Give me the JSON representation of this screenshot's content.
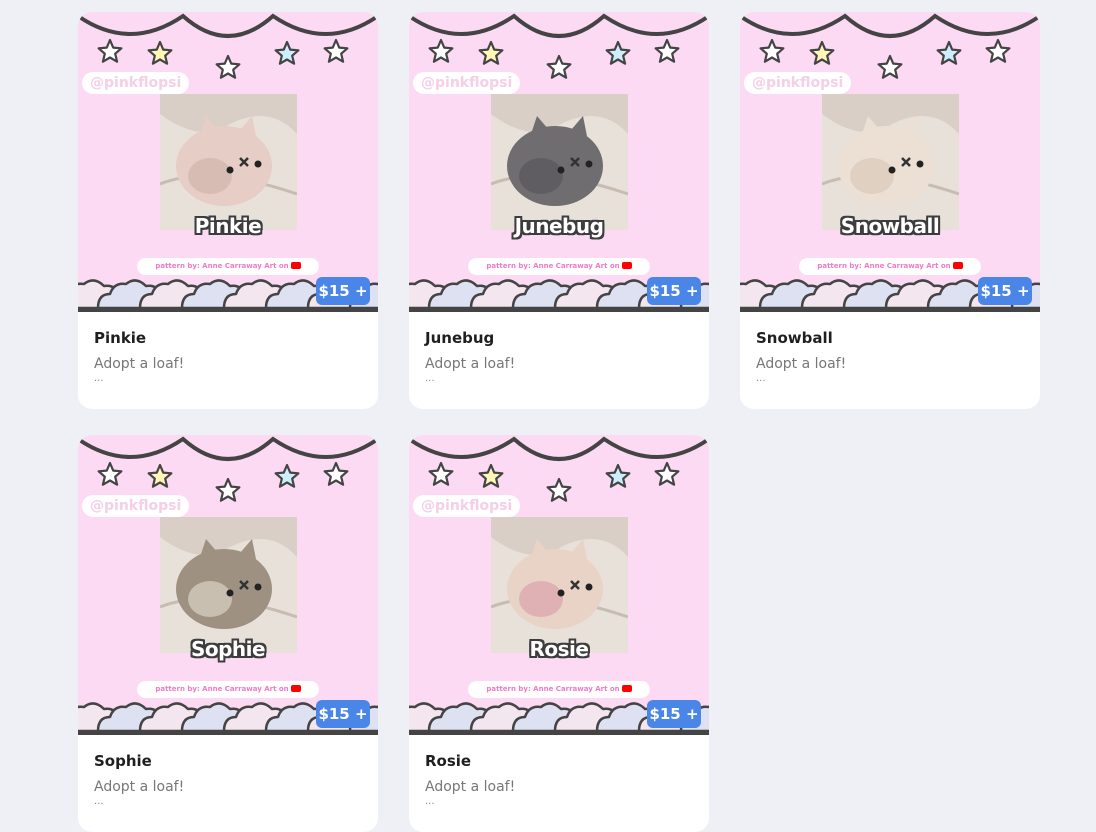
{
  "handle": "@pinkflopsi",
  "credit": "pattern by: Anne Carraway Art on",
  "colors": {
    "background": "#eef0f6",
    "thumb_pink": "#fcdaf3",
    "price_blue": "#4a86e8"
  },
  "products": [
    {
      "name": "Pinkie",
      "desc": "Adopt a loaf!",
      "more": "...",
      "price": "$15 +",
      "plush_color": "#e6cdc5",
      "plush_shade": "#cdb1a8"
    },
    {
      "name": "Junebug",
      "desc": "Adopt a loaf!",
      "more": "...",
      "price": "$15 +",
      "plush_color": "#6f6d70",
      "plush_shade": "#555356"
    },
    {
      "name": "Snowball",
      "desc": "Adopt a loaf!",
      "more": "...",
      "price": "$15 +",
      "plush_color": "#ecdfd3",
      "plush_shade": "#d7c6b6"
    },
    {
      "name": "Sophie",
      "desc": "Adopt a loaf!",
      "more": "...",
      "price": "$15 +",
      "plush_color": "#9e9182",
      "plush_shade": "#e6ddcf"
    },
    {
      "name": "Rosie",
      "desc": "Adopt a loaf!",
      "more": "...",
      "price": "$15 +",
      "plush_color": "#e8d3c6",
      "plush_shade": "#d89aa8"
    }
  ]
}
